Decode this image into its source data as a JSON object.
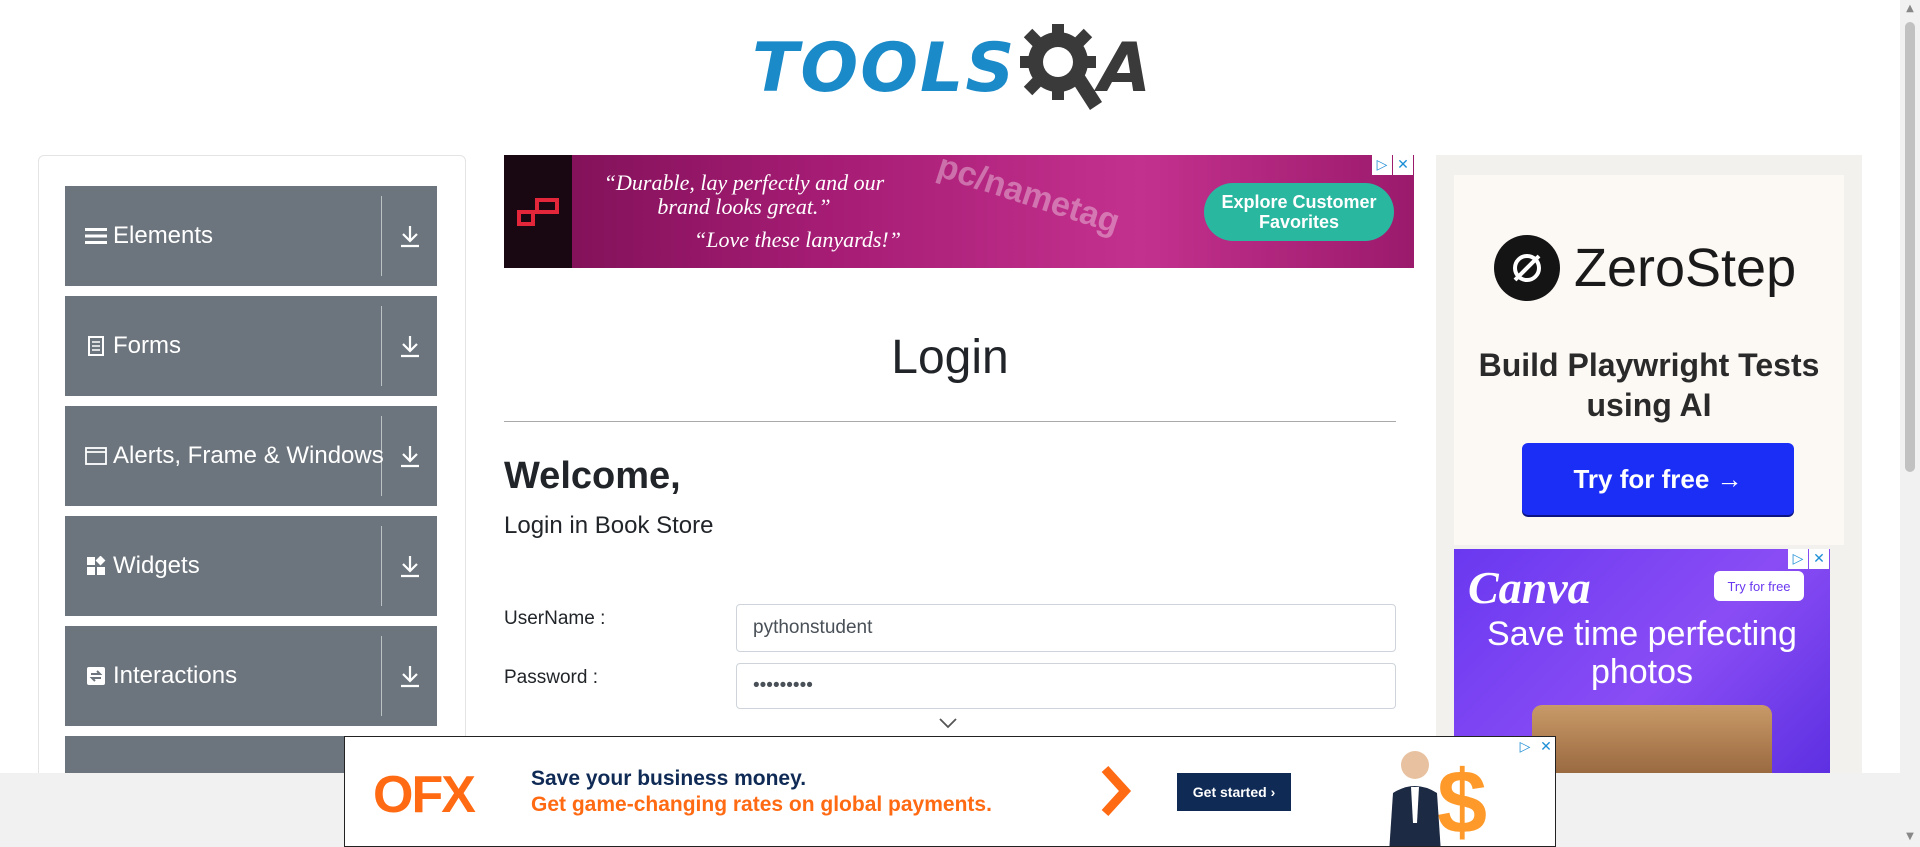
{
  "header": {
    "logo_text": "TOOLS",
    "logo_suffix": "A",
    "logo_alt": "TOOLSQA"
  },
  "sidebar": {
    "groups": [
      {
        "label": "Elements",
        "icon": "hamburger-icon"
      },
      {
        "label": "Forms",
        "icon": "document-icon"
      },
      {
        "label": "Alerts, Frame & Windows",
        "icon": "window-icon"
      },
      {
        "label": "Widgets",
        "icon": "widgets-icon"
      },
      {
        "label": "Interactions",
        "icon": "swap-icon"
      }
    ]
  },
  "ad_top": {
    "quote1": "“Durable, lay perfectly and our brand looks great.”",
    "quote2": "“Love these lanyards!”",
    "watermark": "pc/nametag",
    "cta": "Explore Customer Favorites"
  },
  "main": {
    "title": "Login",
    "welcome": "Welcome,",
    "subtitle": "Login in Book Store",
    "username_label": "UserName :",
    "username_value": "pythonstudent",
    "password_label": "Password :",
    "password_value": "•••••••••"
  },
  "ad_right": {
    "brand": "ZeroStep",
    "tagline": "Build Playwright Tests using AI",
    "cta": "Try for free →",
    "canva_brand": "Canva",
    "canva_try": "Try for free",
    "canva_msg": "Save time perfecting photos"
  },
  "ad_bottom": {
    "brand": "OFX",
    "line1": "Save your business money.",
    "line2": "Get game-changing rates on global payments.",
    "cta": "Get started ›"
  },
  "colors": {
    "sidebar_group": "#6c757d",
    "brand_blue": "#1b8ac9",
    "ofx_orange": "#ff6a13",
    "zerostep_button": "#1a2ef5"
  }
}
